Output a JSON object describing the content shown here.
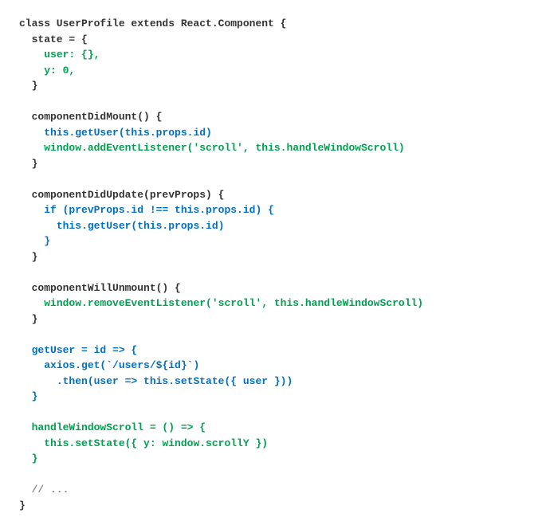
{
  "code": {
    "line1": {
      "a": "class UserProfile extends React.Component {"
    },
    "line2": {
      "a": "  state = {"
    },
    "line3": {
      "a": "    ",
      "b": "user: {},"
    },
    "line4": {
      "a": "    ",
      "b": "y: 0,"
    },
    "line5": {
      "a": "  }"
    },
    "line6": {
      "a": ""
    },
    "line7": {
      "a": "  componentDidMount() {"
    },
    "line8": {
      "a": "    ",
      "b": "this.getUser(this.props.id)"
    },
    "line9": {
      "a": "    ",
      "b": "window.addEventListener('scroll', this.handleWindowScroll)"
    },
    "line10": {
      "a": "  }"
    },
    "line11": {
      "a": ""
    },
    "line12": {
      "a": "  componentDidUpdate(prevProps) {"
    },
    "line13": {
      "a": "    ",
      "b": "if (prevProps.id !== this.props.id) {"
    },
    "line14": {
      "a": "      ",
      "b": "this.getUser(this.props.id)"
    },
    "line15": {
      "a": "    ",
      "b": "}"
    },
    "line16": {
      "a": "  }"
    },
    "line17": {
      "a": ""
    },
    "line18": {
      "a": "  componentWillUnmount() {"
    },
    "line19": {
      "a": "    ",
      "b": "window.removeEventListener('scroll', this.handleWindowScroll)"
    },
    "line20": {
      "a": "  }"
    },
    "line21": {
      "a": ""
    },
    "line22": {
      "a": "  ",
      "b": "getUser = id => {"
    },
    "line23": {
      "a": "    ",
      "b": "axios.get(`/users/${id}`)"
    },
    "line24": {
      "a": "      ",
      "b": ".then(user => this.setState({ user }))"
    },
    "line25": {
      "a": "  ",
      "b": "}"
    },
    "line26": {
      "a": ""
    },
    "line27": {
      "a": "  ",
      "b": "handleWindowScroll = () => {"
    },
    "line28": {
      "a": "    ",
      "b": "this.setState({ y: window.scrollY })"
    },
    "line29": {
      "a": "  ",
      "b": "}"
    },
    "line30": {
      "a": ""
    },
    "line31": {
      "a": "  // ..."
    },
    "line32": {
      "a": "}"
    }
  }
}
